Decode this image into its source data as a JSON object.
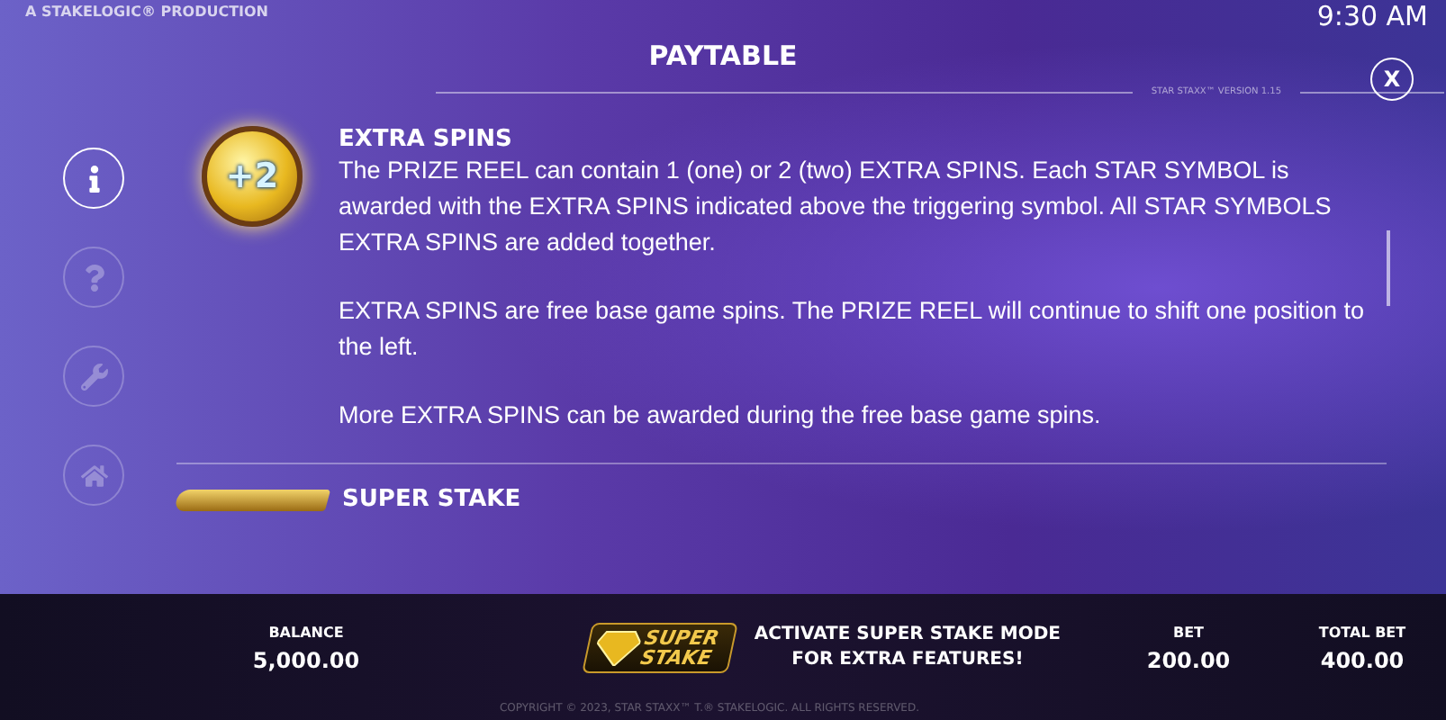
{
  "top_bar": {
    "credit": "A STAKELOGIC® PRODUCTION",
    "time": "9:30 AM"
  },
  "header": {
    "title": "PAYTABLE",
    "version": "STAR STAXX™ VERSION 1.15",
    "close": "X"
  },
  "sidebar": {
    "items": [
      {
        "kind": "info",
        "selected": true
      },
      {
        "kind": "help",
        "selected": false
      },
      {
        "kind": "settings",
        "selected": false
      },
      {
        "kind": "home",
        "selected": false
      }
    ]
  },
  "sections": [
    {
      "kind": "extra-spins",
      "badge": "+2",
      "title": "EXTRA SPINS",
      "paragraphs": [
        "The PRIZE REEL can contain 1 (one) or 2 (two) EXTRA SPINS. Each STAR SYMBOL is awarded with the EXTRA SPINS indicated above the triggering symbol. All STAR SYMBOLS EXTRA SPINS are added together.",
        "EXTRA SPINS are free base game spins. The PRIZE REEL will continue to shift one position to the left.",
        "More EXTRA SPINS can be awarded during the free base game spins."
      ]
    },
    {
      "kind": "super-stake",
      "title": "SUPER STAKE"
    }
  ],
  "footer": {
    "balance_label": "BALANCE",
    "balance": "5,000.00",
    "logo_lines": [
      "SUPER",
      "STAKE"
    ],
    "promo_lines": [
      "ACTIVATE SUPER STAKE MODE",
      "FOR EXTRA FEATURES!"
    ],
    "bet_label": "BET",
    "bet": "200.00",
    "total_bet_label": "TOTAL BET",
    "total_bet": "400.00",
    "copyright": "COPYRIGHT © 2023, STAR STAXX™ T.® STAKELOGIC. ALL RIGHTS RESERVED."
  }
}
